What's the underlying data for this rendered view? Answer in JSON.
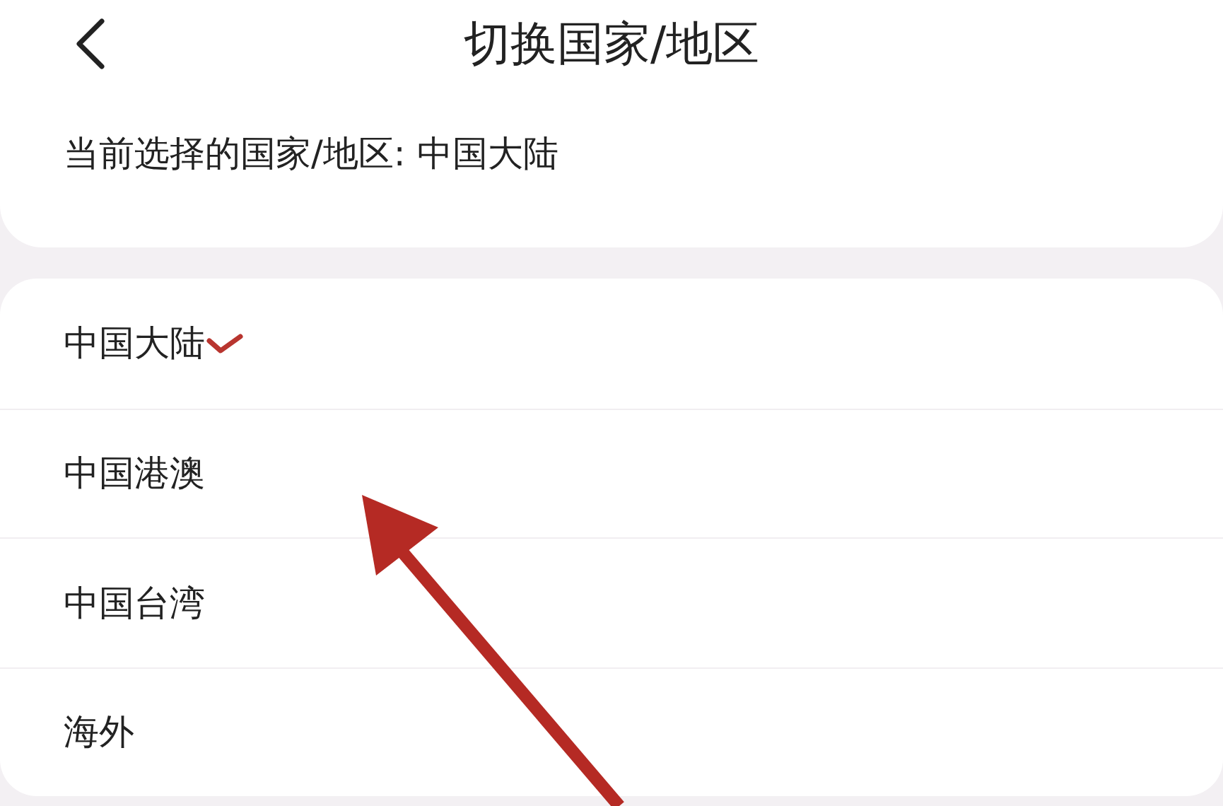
{
  "header": {
    "title": "切换国家/地区"
  },
  "current": {
    "text": "当前选择的国家/地区: 中国大陆"
  },
  "regions": [
    {
      "label": "中国大陆",
      "selected": true
    },
    {
      "label": "中国港澳",
      "selected": false
    },
    {
      "label": "中国台湾",
      "selected": false
    },
    {
      "label": "海外",
      "selected": false
    }
  ],
  "annotation": {
    "kind": "arrow"
  }
}
